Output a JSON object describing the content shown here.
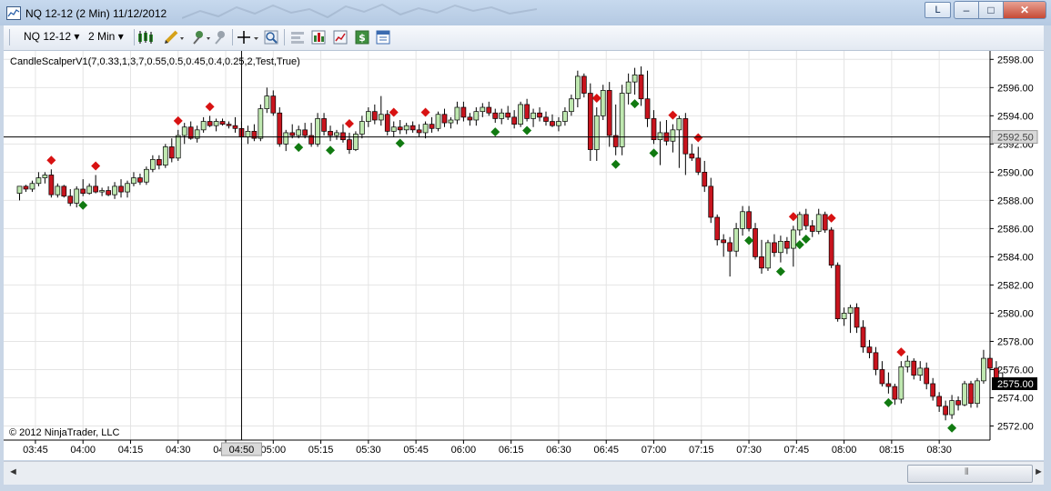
{
  "window": {
    "title": "NQ 12-12 (2 Min)  11/12/2012",
    "l_button": "L",
    "min_glyph": "–",
    "max_glyph": "□",
    "close_glyph": "✕"
  },
  "toolbar": {
    "instrument": "NQ 12-12",
    "interval": "2 Min",
    "dropdown_glyph": "▾",
    "icons": [
      "chart-style-icon",
      "pencil-drawing-icon",
      "pushpin-icon",
      "pin-gray-icon",
      "crosshair-icon",
      "zoom-icon",
      "properties-icon",
      "bar-chart-icon",
      "line-chart-icon",
      "dollar-icon",
      "data-box-icon"
    ]
  },
  "scrollbar": {
    "left_glyph": "◄",
    "right_glyph": "►",
    "grip": "⦀"
  },
  "chart_data": {
    "type": "candlestick",
    "indicator_label": "CandleScalperV1(7,0.33,1,3,7,0.55,0.5,0.45,0.4,0.25,2,Test,True)",
    "copyright": "© 2012 NinjaTrader, LLC",
    "ylim": [
      2571.0,
      2598.6
    ],
    "y_ticks": [
      "2598.00",
      "2596.00",
      "2594.00",
      "2592.00",
      "2590.00",
      "2588.00",
      "2586.00",
      "2584.00",
      "2582.00",
      "2580.00",
      "2578.00",
      "2576.00",
      "2574.00",
      "2572.00"
    ],
    "x_ticks": [
      "03:45",
      "04:00",
      "04:15",
      "04:30",
      "04:45",
      "05:00",
      "05:15",
      "05:30",
      "05:45",
      "06:00",
      "06:15",
      "06:30",
      "06:45",
      "07:00",
      "07:15",
      "07:30",
      "07:45",
      "08:00",
      "08:15",
      "08:30"
    ],
    "x_start": "03:40",
    "bar_minutes": 2,
    "crosshair": {
      "time": "04:50",
      "price": "2592.50"
    },
    "last_price": "2575.00",
    "colors": {
      "up": "#bfe8b0",
      "down": "#c8141e",
      "wick": "#000000",
      "signal_up": "#117a11",
      "signal_down": "#d81212",
      "last_price_bg": "#000000"
    },
    "candles": [
      [
        2588.5,
        2589.0,
        2588.0,
        2589.0
      ],
      [
        2589.0,
        2589.1,
        2588.6,
        2588.8
      ],
      [
        2588.8,
        2589.4,
        2588.6,
        2589.2
      ],
      [
        2589.2,
        2590.0,
        2589.0,
        2589.6
      ],
      [
        2589.6,
        2590.0,
        2589.2,
        2589.8
      ],
      [
        2589.8,
        2590.2,
        2588.2,
        2588.4
      ],
      [
        2588.4,
        2589.2,
        2588.2,
        2589.0
      ],
      [
        2589.0,
        2589.1,
        2588.2,
        2588.3
      ],
      [
        2588.3,
        2588.8,
        2587.6,
        2587.8
      ],
      [
        2587.8,
        2589.0,
        2587.5,
        2588.8
      ],
      [
        2588.8,
        2589.5,
        2588.3,
        2588.5
      ],
      [
        2588.5,
        2589.2,
        2588.4,
        2589.0
      ],
      [
        2589.0,
        2589.8,
        2588.5,
        2588.6
      ],
      [
        2588.6,
        2588.9,
        2588.3,
        2588.7
      ],
      [
        2588.7,
        2589.0,
        2588.3,
        2588.4
      ],
      [
        2588.4,
        2589.3,
        2588.1,
        2589.0
      ],
      [
        2589.0,
        2589.5,
        2588.2,
        2588.6
      ],
      [
        2588.6,
        2589.4,
        2588.2,
        2589.2
      ],
      [
        2589.2,
        2590.0,
        2589.0,
        2589.6
      ],
      [
        2589.6,
        2589.9,
        2589.1,
        2589.3
      ],
      [
        2589.3,
        2590.4,
        2589.1,
        2590.2
      ],
      [
        2590.2,
        2591.2,
        2590.0,
        2590.9
      ],
      [
        2590.9,
        2591.2,
        2590.2,
        2590.5
      ],
      [
        2590.5,
        2592.0,
        2590.3,
        2591.8
      ],
      [
        2591.8,
        2592.4,
        2590.7,
        2591.0
      ],
      [
        2591.0,
        2593.0,
        2590.8,
        2592.6
      ],
      [
        2592.6,
        2593.5,
        2592.0,
        2593.2
      ],
      [
        2593.2,
        2593.6,
        2592.3,
        2592.4
      ],
      [
        2592.4,
        2593.3,
        2592.1,
        2593.0
      ],
      [
        2593.0,
        2593.9,
        2592.8,
        2593.6
      ],
      [
        2593.6,
        2594.0,
        2593.2,
        2593.3
      ],
      [
        2593.3,
        2593.8,
        2592.9,
        2593.6
      ],
      [
        2593.6,
        2593.8,
        2593.3,
        2593.4
      ],
      [
        2593.4,
        2593.6,
        2593.1,
        2593.3
      ],
      [
        2593.3,
        2593.9,
        2592.8,
        2593.1
      ],
      [
        2593.1,
        2593.6,
        2592.3,
        2592.5
      ],
      [
        2592.5,
        2593.3,
        2592.0,
        2592.9
      ],
      [
        2592.9,
        2593.4,
        2592.2,
        2592.4
      ],
      [
        2592.4,
        2594.8,
        2592.2,
        2594.5
      ],
      [
        2594.5,
        2596.0,
        2594.2,
        2595.4
      ],
      [
        2595.4,
        2595.8,
        2594.0,
        2594.2
      ],
      [
        2594.2,
        2594.6,
        2591.8,
        2592.0
      ],
      [
        2592.0,
        2593.0,
        2591.5,
        2592.8
      ],
      [
        2592.8,
        2593.4,
        2592.4,
        2592.6
      ],
      [
        2592.6,
        2593.3,
        2592.4,
        2593.0
      ],
      [
        2593.0,
        2593.5,
        2592.4,
        2592.6
      ],
      [
        2592.6,
        2593.5,
        2591.8,
        2592.0
      ],
      [
        2592.0,
        2594.2,
        2591.8,
        2593.8
      ],
      [
        2593.8,
        2594.2,
        2592.6,
        2592.9
      ],
      [
        2592.9,
        2593.3,
        2592.2,
        2592.6
      ],
      [
        2592.6,
        2593.0,
        2592.3,
        2592.8
      ],
      [
        2592.8,
        2593.4,
        2592.1,
        2592.3
      ],
      [
        2592.3,
        2592.8,
        2591.3,
        2591.6
      ],
      [
        2591.6,
        2592.9,
        2591.5,
        2592.7
      ],
      [
        2592.7,
        2594.0,
        2592.4,
        2593.6
      ],
      [
        2593.6,
        2594.6,
        2593.2,
        2594.3
      ],
      [
        2594.3,
        2594.8,
        2593.4,
        2593.7
      ],
      [
        2593.7,
        2595.4,
        2593.3,
        2594.1
      ],
      [
        2594.1,
        2594.4,
        2592.6,
        2592.9
      ],
      [
        2592.9,
        2593.6,
        2592.5,
        2593.2
      ],
      [
        2593.2,
        2593.7,
        2592.7,
        2593.0
      ],
      [
        2593.0,
        2593.5,
        2592.7,
        2593.3
      ],
      [
        2593.3,
        2593.6,
        2592.8,
        2593.0
      ],
      [
        2593.0,
        2593.4,
        2592.5,
        2592.8
      ],
      [
        2592.8,
        2593.6,
        2592.4,
        2593.4
      ],
      [
        2593.4,
        2593.9,
        2592.8,
        2593.1
      ],
      [
        2593.1,
        2594.3,
        2592.9,
        2594.1
      ],
      [
        2594.1,
        2594.5,
        2593.2,
        2593.5
      ],
      [
        2593.5,
        2593.9,
        2593.1,
        2593.7
      ],
      [
        2593.7,
        2595.0,
        2593.4,
        2594.6
      ],
      [
        2594.6,
        2595.0,
        2593.6,
        2593.9
      ],
      [
        2593.9,
        2594.2,
        2593.3,
        2593.7
      ],
      [
        2593.7,
        2594.6,
        2593.3,
        2594.3
      ],
      [
        2594.3,
        2594.9,
        2593.9,
        2594.6
      ],
      [
        2594.6,
        2595.0,
        2594.0,
        2594.2
      ],
      [
        2594.2,
        2594.5,
        2593.5,
        2593.8
      ],
      [
        2593.8,
        2594.5,
        2593.4,
        2594.2
      ],
      [
        2594.2,
        2594.7,
        2593.7,
        2593.9
      ],
      [
        2593.9,
        2594.4,
        2593.1,
        2593.4
      ],
      [
        2593.4,
        2595.0,
        2593.2,
        2594.8
      ],
      [
        2594.8,
        2595.2,
        2593.6,
        2593.8
      ],
      [
        2593.8,
        2594.5,
        2593.2,
        2594.2
      ],
      [
        2594.2,
        2594.6,
        2593.6,
        2593.9
      ],
      [
        2593.9,
        2594.3,
        2593.3,
        2593.6
      ],
      [
        2593.6,
        2594.1,
        2593.2,
        2593.3
      ],
      [
        2593.3,
        2593.9,
        2592.9,
        2593.6
      ],
      [
        2593.6,
        2594.6,
        2593.3,
        2594.3
      ],
      [
        2594.3,
        2595.5,
        2594.0,
        2595.2
      ],
      [
        2595.2,
        2597.2,
        2594.6,
        2596.8
      ],
      [
        2596.8,
        2597.0,
        2595.3,
        2595.6
      ],
      [
        2595.6,
        2596.3,
        2590.8,
        2591.6
      ],
      [
        2591.6,
        2594.6,
        2590.8,
        2594.0
      ],
      [
        2594.0,
        2596.2,
        2593.7,
        2595.8
      ],
      [
        2595.8,
        2596.4,
        2591.8,
        2592.6
      ],
      [
        2592.6,
        2594.8,
        2591.2,
        2591.8
      ],
      [
        2591.8,
        2596.2,
        2591.2,
        2595.6
      ],
      [
        2595.6,
        2597.0,
        2594.8,
        2596.4
      ],
      [
        2596.4,
        2597.4,
        2595.5,
        2596.9
      ],
      [
        2596.9,
        2597.5,
        2594.7,
        2595.2
      ],
      [
        2595.2,
        2597.2,
        2593.2,
        2593.8
      ],
      [
        2593.8,
        2594.4,
        2592.0,
        2592.3
      ],
      [
        2592.3,
        2593.6,
        2590.5,
        2592.8
      ],
      [
        2592.8,
        2593.7,
        2591.9,
        2592.2
      ],
      [
        2592.2,
        2593.4,
        2591.4,
        2593.0
      ],
      [
        2593.0,
        2594.0,
        2590.3,
        2593.8
      ],
      [
        2593.8,
        2594.2,
        2589.8,
        2591.3
      ],
      [
        2591.3,
        2592.0,
        2590.8,
        2591.0
      ],
      [
        2591.0,
        2591.8,
        2589.8,
        2590.0
      ],
      [
        2590.0,
        2590.8,
        2588.6,
        2589.0
      ],
      [
        2589.0,
        2589.6,
        2586.4,
        2586.8
      ],
      [
        2586.8,
        2587.0,
        2584.8,
        2585.2
      ],
      [
        2585.2,
        2585.6,
        2584.0,
        2585.0
      ],
      [
        2585.0,
        2585.4,
        2582.6,
        2584.4
      ],
      [
        2584.4,
        2586.4,
        2584.0,
        2586.0
      ],
      [
        2586.0,
        2587.6,
        2585.5,
        2587.2
      ],
      [
        2587.2,
        2587.6,
        2585.8,
        2586.0
      ],
      [
        2586.0,
        2586.4,
        2583.8,
        2584.0
      ],
      [
        2584.0,
        2585.2,
        2582.8,
        2583.2
      ],
      [
        2583.2,
        2585.2,
        2583.0,
        2585.0
      ],
      [
        2585.0,
        2585.6,
        2584.0,
        2584.3
      ],
      [
        2584.3,
        2585.5,
        2583.6,
        2585.1
      ],
      [
        2585.1,
        2585.4,
        2584.2,
        2584.6
      ],
      [
        2584.6,
        2586.2,
        2583.3,
        2585.9
      ],
      [
        2585.9,
        2587.2,
        2585.5,
        2587.0
      ],
      [
        2587.0,
        2587.4,
        2585.9,
        2586.2
      ],
      [
        2586.2,
        2586.6,
        2585.4,
        2585.8
      ],
      [
        2585.8,
        2587.4,
        2585.6,
        2587.0
      ],
      [
        2587.0,
        2587.2,
        2585.7,
        2585.9
      ],
      [
        2585.9,
        2586.1,
        2583.2,
        2583.4
      ],
      [
        2583.4,
        2583.6,
        2579.4,
        2579.6
      ],
      [
        2579.6,
        2580.4,
        2579.1,
        2580.0
      ],
      [
        2580.0,
        2580.6,
        2578.6,
        2580.4
      ],
      [
        2580.4,
        2580.7,
        2578.6,
        2579.0
      ],
      [
        2579.0,
        2579.5,
        2577.2,
        2577.6
      ],
      [
        2577.6,
        2578.1,
        2576.8,
        2577.2
      ],
      [
        2577.2,
        2577.6,
        2575.6,
        2576.0
      ],
      [
        2576.0,
        2576.6,
        2574.8,
        2575.0
      ],
      [
        2575.0,
        2575.8,
        2574.3,
        2574.8
      ],
      [
        2574.8,
        2575.0,
        2573.5,
        2573.9
      ],
      [
        2573.9,
        2576.6,
        2573.6,
        2576.2
      ],
      [
        2576.2,
        2577.0,
        2575.8,
        2576.6
      ],
      [
        2576.6,
        2576.8,
        2575.3,
        2575.6
      ],
      [
        2575.6,
        2576.6,
        2575.2,
        2576.1
      ],
      [
        2576.1,
        2576.5,
        2574.6,
        2575.0
      ],
      [
        2575.0,
        2575.4,
        2573.8,
        2574.1
      ],
      [
        2574.1,
        2574.4,
        2573.0,
        2573.4
      ],
      [
        2573.4,
        2573.8,
        2572.4,
        2572.8
      ],
      [
        2572.8,
        2574.2,
        2572.5,
        2573.8
      ],
      [
        2573.8,
        2574.1,
        2573.1,
        2573.5
      ],
      [
        2573.5,
        2575.2,
        2573.4,
        2575.0
      ],
      [
        2575.0,
        2575.2,
        2573.3,
        2573.6
      ],
      [
        2573.6,
        2575.4,
        2573.3,
        2575.2
      ],
      [
        2575.2,
        2577.4,
        2575.0,
        2576.8
      ],
      [
        2576.8,
        2577.1,
        2575.8,
        2576.1
      ],
      [
        2576.1,
        2576.6,
        2575.1,
        2575.4
      ],
      [
        2575.4,
        2575.8,
        2574.9,
        2575.0
      ]
    ],
    "signals": [
      {
        "bar": 5,
        "dir": "down"
      },
      {
        "bar": 10,
        "dir": "up"
      },
      {
        "bar": 12,
        "dir": "down"
      },
      {
        "bar": 25,
        "dir": "down"
      },
      {
        "bar": 30,
        "dir": "down"
      },
      {
        "bar": 44,
        "dir": "up"
      },
      {
        "bar": 49,
        "dir": "up"
      },
      {
        "bar": 52,
        "dir": "down"
      },
      {
        "bar": 59,
        "dir": "down"
      },
      {
        "bar": 60,
        "dir": "up"
      },
      {
        "bar": 64,
        "dir": "down"
      },
      {
        "bar": 75,
        "dir": "up"
      },
      {
        "bar": 80,
        "dir": "up"
      },
      {
        "bar": 91,
        "dir": "down"
      },
      {
        "bar": 94,
        "dir": "up"
      },
      {
        "bar": 97,
        "dir": "up"
      },
      {
        "bar": 100,
        "dir": "up"
      },
      {
        "bar": 103,
        "dir": "down"
      },
      {
        "bar": 107,
        "dir": "down"
      },
      {
        "bar": 115,
        "dir": "up"
      },
      {
        "bar": 120,
        "dir": "up"
      },
      {
        "bar": 122,
        "dir": "down"
      },
      {
        "bar": 123,
        "dir": "up"
      },
      {
        "bar": 124,
        "dir": "up"
      },
      {
        "bar": 128,
        "dir": "down"
      },
      {
        "bar": 137,
        "dir": "up"
      },
      {
        "bar": 139,
        "dir": "down"
      },
      {
        "bar": 147,
        "dir": "up"
      }
    ]
  }
}
